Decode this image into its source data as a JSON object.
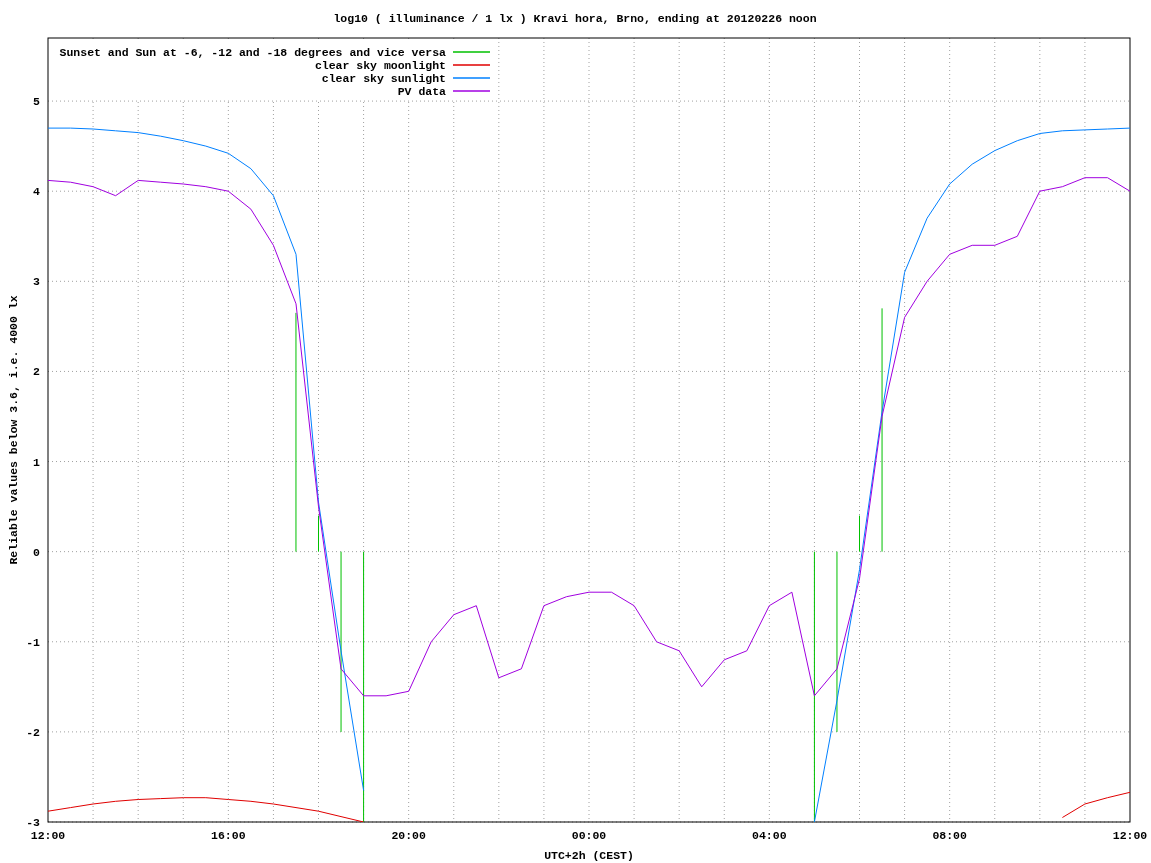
{
  "chart_data": {
    "type": "line",
    "title": "log10 ( illuminance / 1 lx ) Kravi hora, Brno, ending at 20120226 noon",
    "xlabel": "UTC+2h (CEST)",
    "ylabel": "Reliable values below 3.6, i.e. 4000 lx",
    "categories": [
      "12:00",
      null,
      null,
      null,
      null,
      null,
      null,
      null,
      "16:00",
      null,
      null,
      null,
      null,
      null,
      null,
      null,
      "20:00",
      null,
      null,
      null,
      null,
      null,
      null,
      null,
      "00:00",
      null,
      null,
      null,
      null,
      null,
      null,
      null,
      "04:00",
      null,
      null,
      null,
      null,
      null,
      null,
      null,
      "08:00",
      null,
      null,
      null,
      null,
      null,
      null,
      null,
      "12:00"
    ],
    "grid": true,
    "legend": true,
    "series": [
      {
        "name": "Sunset and Sun at -6, -12 and -18 degrees and vice versa",
        "color": "#00c000",
        "type": "bar",
        "values": [
          null,
          null,
          null,
          null,
          null,
          null,
          null,
          null,
          null,
          null,
          null,
          2.65,
          0.4,
          -2,
          -3,
          null,
          null,
          null,
          null,
          null,
          null,
          null,
          null,
          null,
          null,
          null,
          null,
          null,
          null,
          null,
          null,
          null,
          null,
          null,
          -3,
          -2,
          0.4,
          2.7,
          null,
          null,
          null,
          null,
          null,
          null,
          null,
          null,
          null,
          null,
          null
        ]
      },
      {
        "name": "clear sky moonlight",
        "color": "#e00000",
        "values": [
          -2.88,
          -2.84,
          -2.8,
          -2.77,
          -2.75,
          -2.74,
          -2.73,
          -2.73,
          -2.75,
          -2.77,
          -2.8,
          -2.84,
          -2.88,
          -2.94,
          -3.0,
          null,
          null,
          null,
          null,
          null,
          null,
          null,
          null,
          null,
          null,
          null,
          null,
          null,
          null,
          null,
          null,
          null,
          null,
          null,
          null,
          null,
          null,
          null,
          null,
          null,
          null,
          null,
          null,
          null,
          null,
          -2.95,
          -2.8,
          -2.73,
          -2.67
        ]
      },
      {
        "name": "clear sky sunlight",
        "color": "#0080ff",
        "values": [
          4.7,
          4.7,
          4.69,
          4.67,
          4.65,
          4.61,
          4.56,
          4.5,
          4.42,
          4.25,
          3.95,
          3.3,
          0.55,
          -1.1,
          -2.65,
          null,
          null,
          null,
          null,
          null,
          null,
          null,
          null,
          null,
          null,
          null,
          null,
          null,
          null,
          null,
          null,
          null,
          null,
          null,
          -3.0,
          -1.65,
          -0.2,
          1.55,
          3.1,
          3.7,
          4.08,
          4.3,
          4.45,
          4.56,
          4.64,
          4.67,
          4.68,
          4.69,
          4.7
        ]
      },
      {
        "name": "PV data",
        "color": "#a000e0",
        "values": [
          4.12,
          4.1,
          4.05,
          3.95,
          4.12,
          4.1,
          4.08,
          4.05,
          4.0,
          3.8,
          3.4,
          2.75,
          0.5,
          -1.3,
          -1.6,
          -1.6,
          -1.55,
          -1.0,
          -0.7,
          -0.6,
          -1.4,
          -1.3,
          -0.6,
          -0.5,
          -0.45,
          -0.45,
          -0.6,
          -1.0,
          -1.1,
          -1.5,
          -1.2,
          -1.1,
          -0.6,
          -0.45,
          -1.6,
          -1.3,
          -0.3,
          1.5,
          2.6,
          3.0,
          3.3,
          3.4,
          3.4,
          3.5,
          4.0,
          4.05,
          4.15,
          4.15,
          4.0
        ]
      }
    ],
    "ylim": [
      -3,
      5.7
    ],
    "yticks": [
      -3,
      -2,
      -1,
      0,
      1,
      2,
      3,
      4,
      5
    ]
  }
}
